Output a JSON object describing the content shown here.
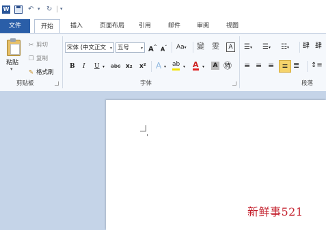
{
  "qat": {
    "logo": "W",
    "undo": "↶",
    "redo": "↻",
    "dropdown": "▾",
    "sep": "|"
  },
  "tabs": {
    "file": "文件",
    "items": [
      "开始",
      "插入",
      "页面布局",
      "引用",
      "邮件",
      "审阅",
      "视图"
    ]
  },
  "clipboard": {
    "paste": "粘贴",
    "cut": "剪切",
    "copy": "复制",
    "format_painter": "格式刷",
    "group_label": "剪贴板",
    "arrow": "▾"
  },
  "font": {
    "font_name": "宋体 (中文正文",
    "font_size": "五号",
    "grow": "A",
    "shrink": "A",
    "case": "Aa",
    "phonetic": "變",
    "charset": "雯",
    "border": "A",
    "bold": "B",
    "italic": "I",
    "underline": "U",
    "strike": "abc",
    "subscript": "x₂",
    "superscript": "x²",
    "effects": "A",
    "highlight": "ab",
    "color": "A",
    "shading": "A",
    "enclose": "㊕",
    "group_label": "字体"
  },
  "paragraph": {
    "indent_dec": "肆",
    "indent_inc": "肆",
    "group_label": "段落"
  },
  "colors": {
    "file_tab": "#2a5ea8",
    "watermark": "#c31d2a",
    "font_color_bar": "#e02020",
    "highlight_bar": "#f3e300"
  },
  "watermark": "新鲜事521"
}
